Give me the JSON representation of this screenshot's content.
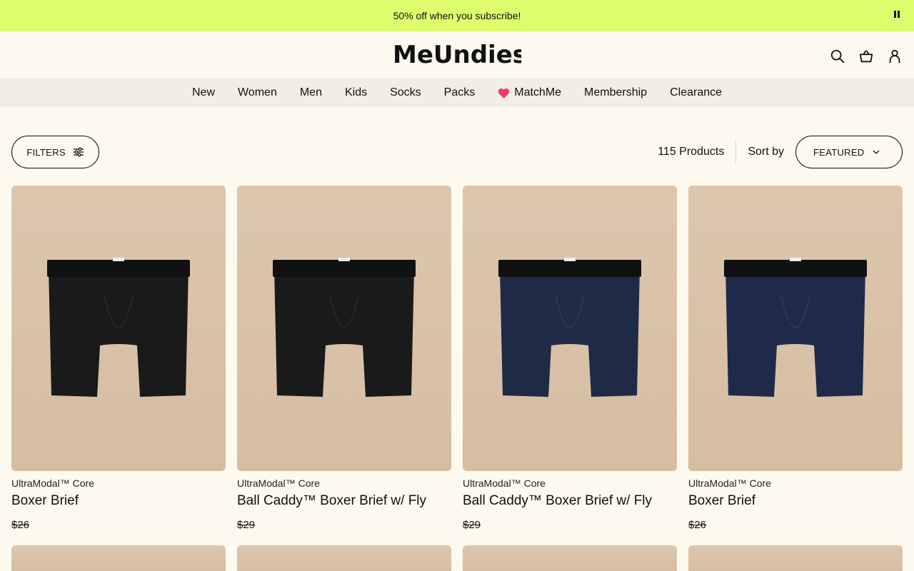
{
  "promo": {
    "text": "50% off when you subscribe!"
  },
  "header": {
    "logo": "MeUndies",
    "icons": [
      "search-icon",
      "cart-icon",
      "account-icon"
    ]
  },
  "nav": {
    "items": [
      {
        "label": "New"
      },
      {
        "label": "Women"
      },
      {
        "label": "Men"
      },
      {
        "label": "Kids"
      },
      {
        "label": "Socks"
      },
      {
        "label": "Packs"
      },
      {
        "label": "MatchMe",
        "icon": "heart-icon"
      },
      {
        "label": "Membership"
      },
      {
        "label": "Clearance"
      }
    ]
  },
  "toolbar": {
    "filters_label": "FILTERS",
    "count": "115 Products",
    "sort_label": "Sort by",
    "sort_value": "FEATURED"
  },
  "products": [
    {
      "line": "UltraModal™ Core",
      "title": "Boxer Brief",
      "price": "$26",
      "color": "#1a1a1a"
    },
    {
      "line": "UltraModal™ Core",
      "title": "Ball Caddy™ Boxer Brief w/ Fly",
      "price": "$29",
      "color": "#1a1a1a"
    },
    {
      "line": "UltraModal™ Core",
      "title": "Ball Caddy™ Boxer Brief w/ Fly",
      "price": "$29",
      "color": "#1f2a47"
    },
    {
      "line": "UltraModal™ Core",
      "title": "Boxer Brief",
      "price": "$26",
      "color": "#1f2a4a"
    }
  ],
  "colors": {
    "promo_bg": "#ddfd6d",
    "page_bg": "#fdf9ee",
    "nav_bg": "#f1eee6",
    "heart": "#f03c6a"
  }
}
